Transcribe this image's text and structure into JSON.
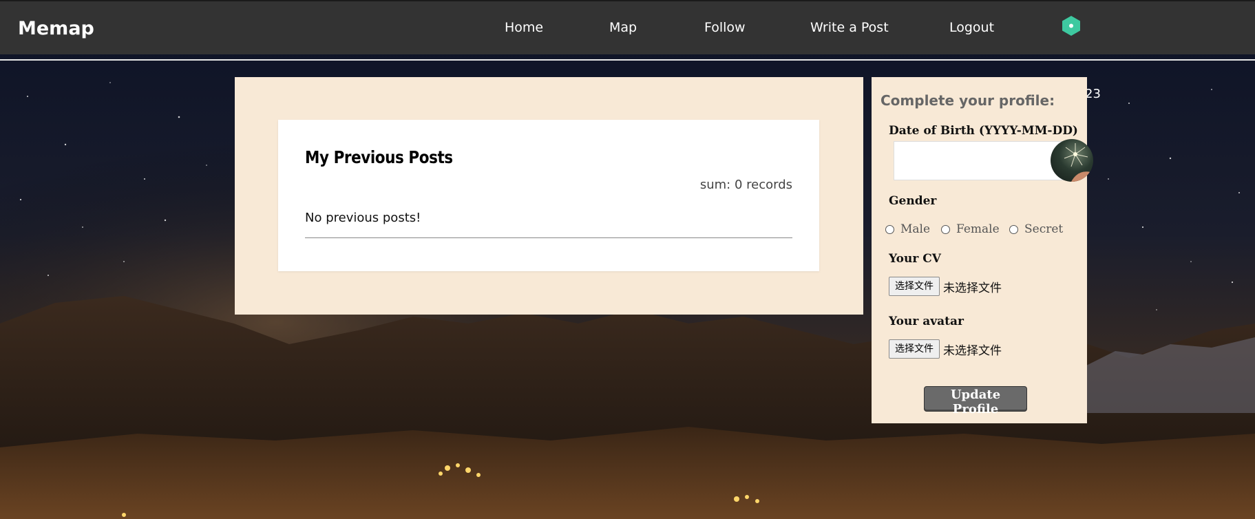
{
  "header": {
    "brand": "Memap",
    "nav": [
      {
        "label": "Home"
      },
      {
        "label": "Map"
      },
      {
        "label": "Follow"
      },
      {
        "label": "Write a Post"
      },
      {
        "label": "Logout"
      }
    ],
    "hex_icon": "hexagon-logo-icon",
    "hex_color": "#3ec9a0"
  },
  "posts": {
    "title": "My Previous Posts",
    "sum": "sum: 0 records",
    "empty": "No previous posts!"
  },
  "side_number": "23",
  "profile": {
    "title": "Complete your profile:",
    "dob_label": "Date of Birth (YYYY-MM-DD)",
    "dob_value": "",
    "gender_label": "Gender",
    "gender_options": [
      "Male",
      "Female",
      "Secret"
    ],
    "cv_label": "Your CV",
    "avatar_label": "Your avatar",
    "file_button": "选择文件",
    "file_status": "未选择文件",
    "submit_label": "Update Profile"
  },
  "colors": {
    "topbar": "#333333",
    "panel": "#f8e9d6",
    "accent": "#3ec9a0",
    "button": "#6a6a6a"
  }
}
